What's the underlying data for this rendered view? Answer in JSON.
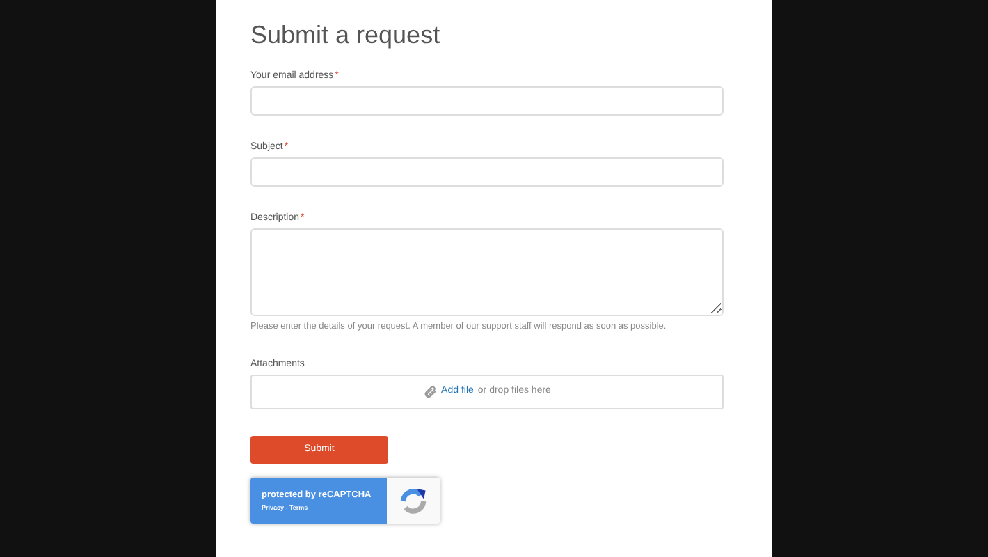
{
  "title": "Submit a request",
  "fields": [
    {
      "kind": "input",
      "label": "Your email address",
      "required_mark": "*"
    },
    {
      "kind": "input",
      "label": "Subject",
      "required_mark": "*"
    },
    {
      "kind": "textarea",
      "label": "Description",
      "required_mark": "*",
      "hint": "Please enter the details of your request. A member of our support staff will respond as soon as possible."
    },
    {
      "kind": "attachments",
      "label": "Attachments",
      "link": "Add file",
      "text": "or drop files here"
    }
  ],
  "submit": "Submit",
  "recaptcha": {
    "text": "protected by reCAPTCHA",
    "links": "Privacy - Terms"
  }
}
